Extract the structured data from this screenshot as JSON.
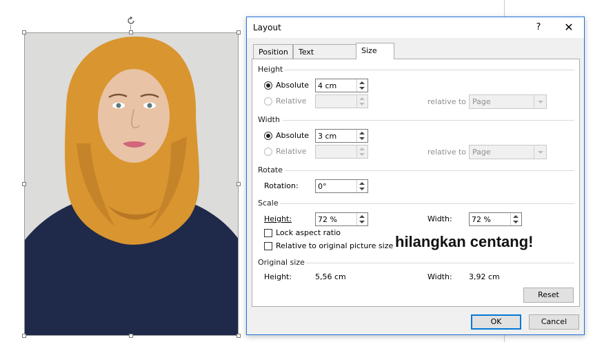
{
  "dialog": {
    "title": "Layout",
    "help_label": "?",
    "close_label": "✕",
    "tabs": [
      {
        "label": "Position",
        "active": false
      },
      {
        "label": "Text Wrapping",
        "active": false
      },
      {
        "label": "Size",
        "active": true
      }
    ]
  },
  "height": {
    "section_label": "Height",
    "absolute_label": "Absolute",
    "absolute_value": "4 cm",
    "absolute_checked": true,
    "relative_label": "Relative",
    "relative_value": "",
    "relative_to_label": "relative to",
    "relative_to_value": "Page"
  },
  "width": {
    "section_label": "Width",
    "absolute_label": "Absolute",
    "absolute_value": "3 cm",
    "absolute_checked": true,
    "relative_label": "Relative",
    "relative_value": "",
    "relative_to_label": "relative to",
    "relative_to_value": "Page"
  },
  "rotate": {
    "section_label": "Rotate",
    "rotation_label": "Rotation:",
    "rotation_value": "0°"
  },
  "scale": {
    "section_label": "Scale",
    "height_label": "Height:",
    "height_value": "72 %",
    "width_label": "Width:",
    "width_value": "72 %",
    "lock_aspect_label": "Lock aspect ratio",
    "lock_aspect_checked": false,
    "relative_original_label": "Relative to original picture size",
    "relative_original_checked": false
  },
  "original_size": {
    "section_label": "Original size",
    "height_label": "Height:",
    "height_value": "5,56 cm",
    "width_label": "Width:",
    "width_value": "3,92 cm"
  },
  "buttons": {
    "reset": "Reset",
    "ok": "OK",
    "cancel": "Cancel"
  },
  "annotation": "hilangkan centang!",
  "colors": {
    "accent": "#0078d7",
    "hijab": "#d9952f",
    "shirt": "#1f2a4a",
    "photo_bg": "#d9d9d7"
  }
}
